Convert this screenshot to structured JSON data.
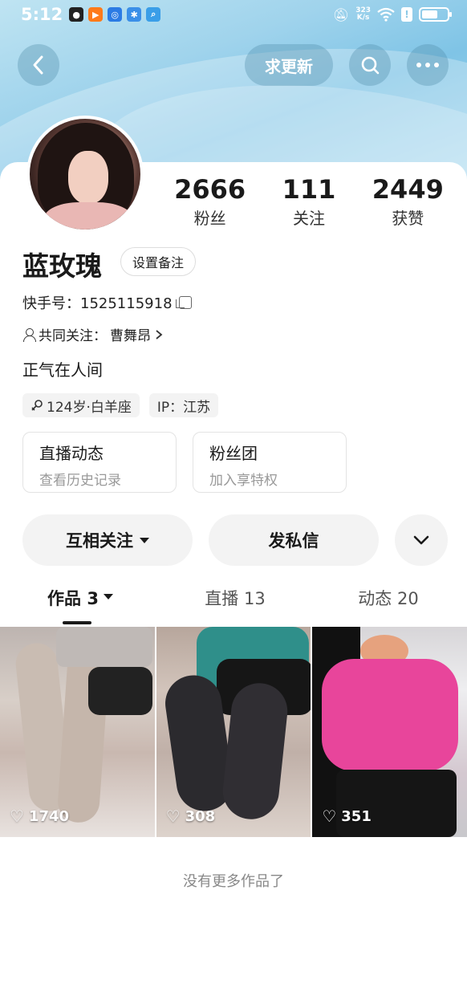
{
  "status_bar": {
    "time": "5:12",
    "net_speed_value": "323",
    "net_speed_unit": "K/s",
    "notif_icons": [
      "qq-icon",
      "play-icon",
      "browser-icon",
      "settings-icon",
      "search-app-icon"
    ]
  },
  "nav": {
    "update_label": "求更新"
  },
  "profile": {
    "name": "蓝玫瑰",
    "remark_label": "设置备注",
    "kuaishou_id_label": "快手号：",
    "kuaishou_id": "1525115918",
    "mutual_label": "共同关注：",
    "mutual_name": "曹舞昂",
    "bio": "正气在人间",
    "tags": {
      "age": "124岁·白羊座",
      "ip": "IP：江苏"
    }
  },
  "stats": [
    {
      "value": "2666",
      "label": "粉丝"
    },
    {
      "value": "111",
      "label": "关注"
    },
    {
      "value": "2449",
      "label": "获赞"
    }
  ],
  "features": [
    {
      "title": "直播动态",
      "subtitle": "查看历史记录"
    },
    {
      "title": "粉丝团",
      "subtitle": "加入享特权"
    }
  ],
  "actions": {
    "follow_label": "互相关注",
    "message_label": "发私信"
  },
  "tabs": [
    {
      "label": "作品 3"
    },
    {
      "label": "直播 13"
    },
    {
      "label": "动态 20"
    }
  ],
  "works": [
    {
      "likes": "1740"
    },
    {
      "likes": "308"
    },
    {
      "likes": "351"
    }
  ],
  "footer_note": "没有更多作品了",
  "colors": {
    "header_bg": "#9fd3ec",
    "text_primary": "#1a1a1a",
    "text_secondary": "#999999",
    "button_bg": "#f3f3f3"
  }
}
